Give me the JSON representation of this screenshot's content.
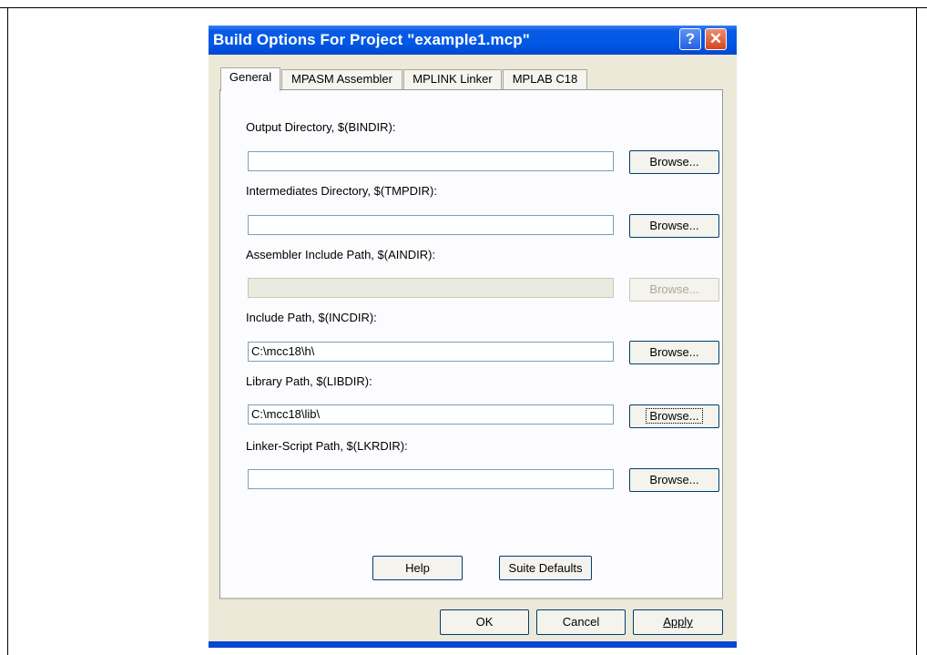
{
  "dialog": {
    "title": "Build Options For Project \"example1.mcp\"",
    "help_glyph": "?",
    "close_glyph": "✕"
  },
  "tabs": [
    {
      "label": "General",
      "active": true
    },
    {
      "label": "MPASM Assembler",
      "active": false
    },
    {
      "label": "MPLINK Linker",
      "active": false
    },
    {
      "label": "MPLAB C18",
      "active": false
    }
  ],
  "fields": [
    {
      "label": "Output Directory, $(BINDIR):",
      "value": "",
      "enabled": true,
      "button": "Browse..."
    },
    {
      "label": "Intermediates Directory, $(TMPDIR):",
      "value": "",
      "enabled": true,
      "button": "Browse..."
    },
    {
      "label": "Assembler Include Path, $(AINDIR):",
      "value": "",
      "enabled": false,
      "button": "Browse..."
    },
    {
      "label": "Include Path, $(INCDIR):",
      "value": "C:\\mcc18\\h\\",
      "enabled": true,
      "button": "Browse..."
    },
    {
      "label": "Library Path, $(LIBDIR):",
      "value": "C:\\mcc18\\lib\\",
      "enabled": true,
      "button": "Browse...",
      "focused": true
    },
    {
      "label": "Linker-Script Path, $(LKRDIR):",
      "value": "",
      "enabled": true,
      "button": "Browse..."
    }
  ],
  "panel_buttons": {
    "help": "Help",
    "suite_defaults": "Suite Defaults"
  },
  "footer_buttons": {
    "ok": "OK",
    "cancel": "Cancel",
    "apply": "Apply"
  }
}
